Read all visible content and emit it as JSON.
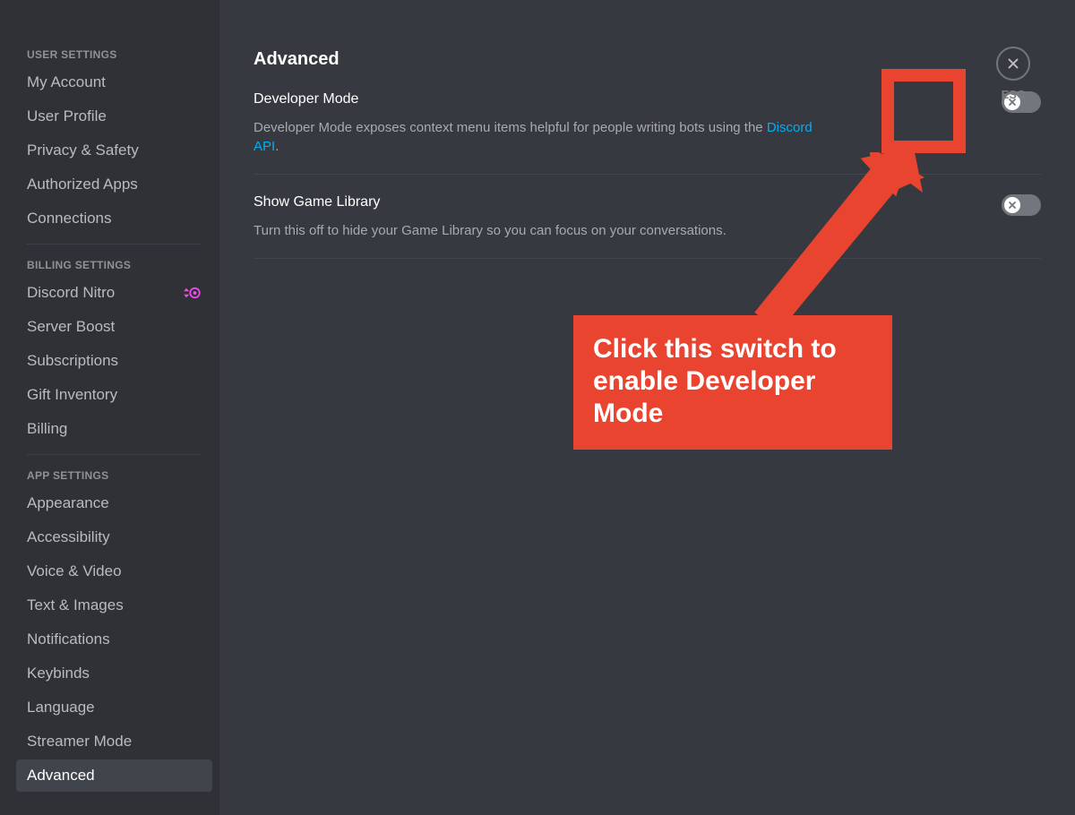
{
  "sidebar": {
    "sections": [
      {
        "header": "USER SETTINGS",
        "items": [
          {
            "label": "My Account",
            "key": "my-account"
          },
          {
            "label": "User Profile",
            "key": "user-profile"
          },
          {
            "label": "Privacy & Safety",
            "key": "privacy-safety"
          },
          {
            "label": "Authorized Apps",
            "key": "authorized-apps"
          },
          {
            "label": "Connections",
            "key": "connections"
          }
        ]
      },
      {
        "header": "BILLING SETTINGS",
        "items": [
          {
            "label": "Discord Nitro",
            "key": "discord-nitro",
            "badge": "nitro"
          },
          {
            "label": "Server Boost",
            "key": "server-boost"
          },
          {
            "label": "Subscriptions",
            "key": "subscriptions"
          },
          {
            "label": "Gift Inventory",
            "key": "gift-inventory"
          },
          {
            "label": "Billing",
            "key": "billing"
          }
        ]
      },
      {
        "header": "APP SETTINGS",
        "items": [
          {
            "label": "Appearance",
            "key": "appearance"
          },
          {
            "label": "Accessibility",
            "key": "accessibility"
          },
          {
            "label": "Voice & Video",
            "key": "voice-video"
          },
          {
            "label": "Text & Images",
            "key": "text-images"
          },
          {
            "label": "Notifications",
            "key": "notifications"
          },
          {
            "label": "Keybinds",
            "key": "keybinds"
          },
          {
            "label": "Language",
            "key": "language"
          },
          {
            "label": "Streamer Mode",
            "key": "streamer-mode"
          },
          {
            "label": "Advanced",
            "key": "advanced",
            "selected": true
          }
        ]
      }
    ]
  },
  "main": {
    "title": "Advanced",
    "settings": [
      {
        "title": "Developer Mode",
        "desc_prefix": "Developer Mode exposes context menu items helpful for people writing bots using the ",
        "link_text": "Discord API",
        "desc_suffix": ".",
        "enabled": false
      },
      {
        "title": "Show Game Library",
        "desc": "Turn this off to hide your Game Library so you can focus on your conversations.",
        "enabled": false
      }
    ],
    "close_label": "ESC"
  },
  "annotation": {
    "callout": "Click this switch to enable Developer Mode"
  }
}
